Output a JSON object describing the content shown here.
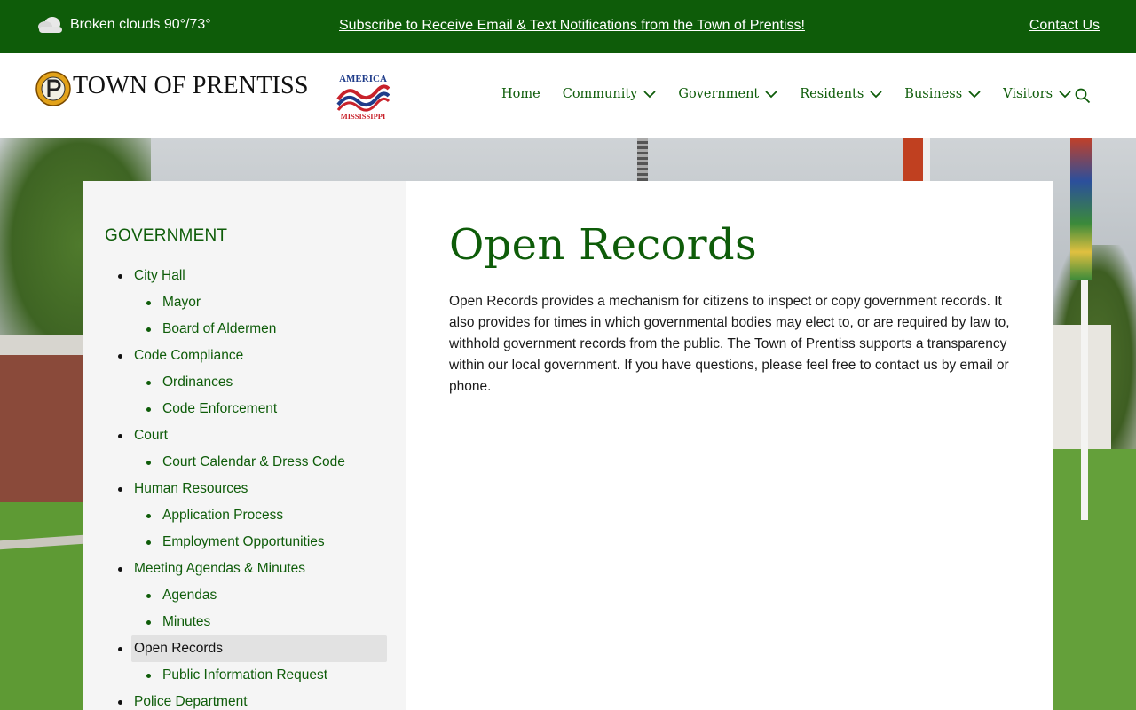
{
  "topbar": {
    "weather": "Broken clouds 90°/73°",
    "subscribe": "Subscribe to Receive Email & Text Notifications from the Town of Prentiss!",
    "contact": "Contact Us"
  },
  "header": {
    "title": "TOWN OF PRENTISS",
    "america_logo_text": "AMERICA 250 MISSISSIPPI",
    "nav": [
      "Home",
      "Community",
      "Government",
      "Residents",
      "Business",
      "Visitors"
    ]
  },
  "sidebar": {
    "heading": "GOVERNMENT",
    "items": [
      {
        "label": "City Hall",
        "level": 1
      },
      {
        "label": "Mayor",
        "level": 2
      },
      {
        "label": "Board of Aldermen",
        "level": 2
      },
      {
        "label": "Code Compliance",
        "level": 1
      },
      {
        "label": "Ordinances",
        "level": 2
      },
      {
        "label": "Code Enforcement",
        "level": 2
      },
      {
        "label": "Court",
        "level": 1
      },
      {
        "label": "Court Calendar & Dress Code",
        "level": 2
      },
      {
        "label": "Human Resources",
        "level": 1
      },
      {
        "label": "Application Process",
        "level": 2
      },
      {
        "label": "Employment Opportunities",
        "level": 2
      },
      {
        "label": "Meeting Agendas & Minutes",
        "level": 1
      },
      {
        "label": "Agendas",
        "level": 2
      },
      {
        "label": "Minutes",
        "level": 2
      },
      {
        "label": "Open Records",
        "level": 1,
        "active": true
      },
      {
        "label": "Public Information Request",
        "level": 2
      },
      {
        "label": "Police Department",
        "level": 1
      }
    ]
  },
  "main": {
    "title": "Open Records",
    "body": "Open Records provides a mechanism for citizens to inspect or copy government records. It also provides for times in which governmental bodies may elect to, or are required by law to, withhold government records from the public. The Town of Prentiss supports a transparency within our local government. If you have questions, please feel free to contact us by email or phone."
  },
  "colors": {
    "brand_green": "#0e5c09",
    "sidebar_bg": "#f5f5f5",
    "active_bg": "#e2e2e2"
  },
  "icons": [
    "cloud-icon",
    "town-seal-logo",
    "america250-logo",
    "chevron-down-icon",
    "search-icon"
  ]
}
